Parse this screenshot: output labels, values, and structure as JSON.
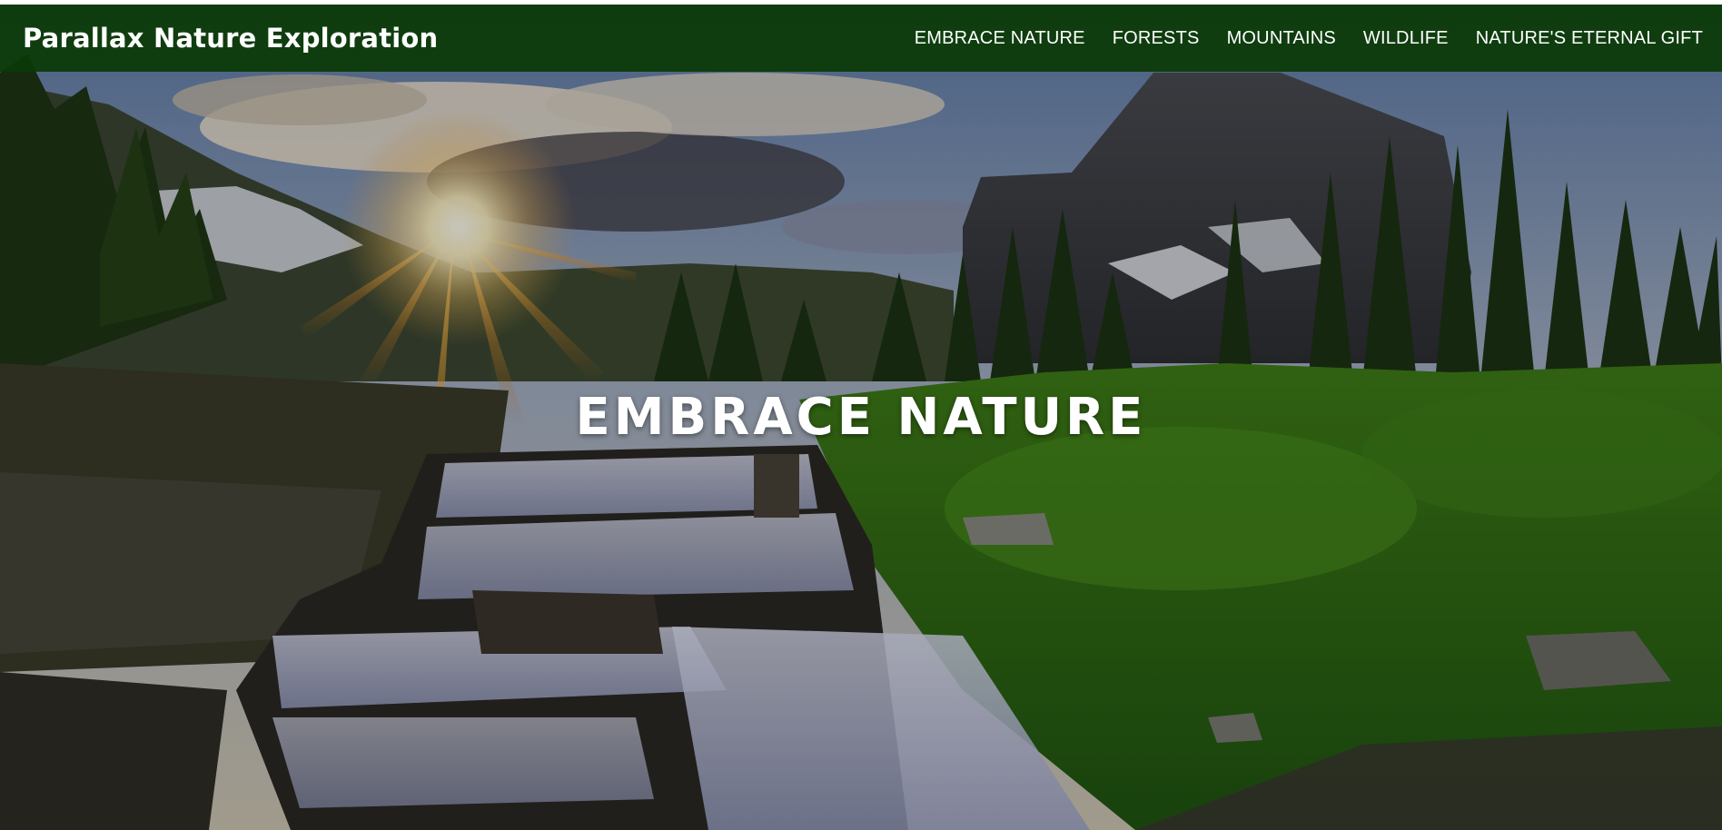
{
  "navbar": {
    "brand": "Parallax Nature Exploration",
    "links": [
      {
        "label": "EMBRACE NATURE"
      },
      {
        "label": "FORESTS"
      },
      {
        "label": "MOUNTAINS"
      },
      {
        "label": "WILDLIFE"
      },
      {
        "label": "NATURE'S ETERNAL GIFT"
      }
    ]
  },
  "hero": {
    "title": "EMBRACE NATURE",
    "image_subject": "mountain-waterfall-sunburst-photo"
  },
  "colors": {
    "navbar_bg": "#0a3a05",
    "text": "#ffffff"
  }
}
